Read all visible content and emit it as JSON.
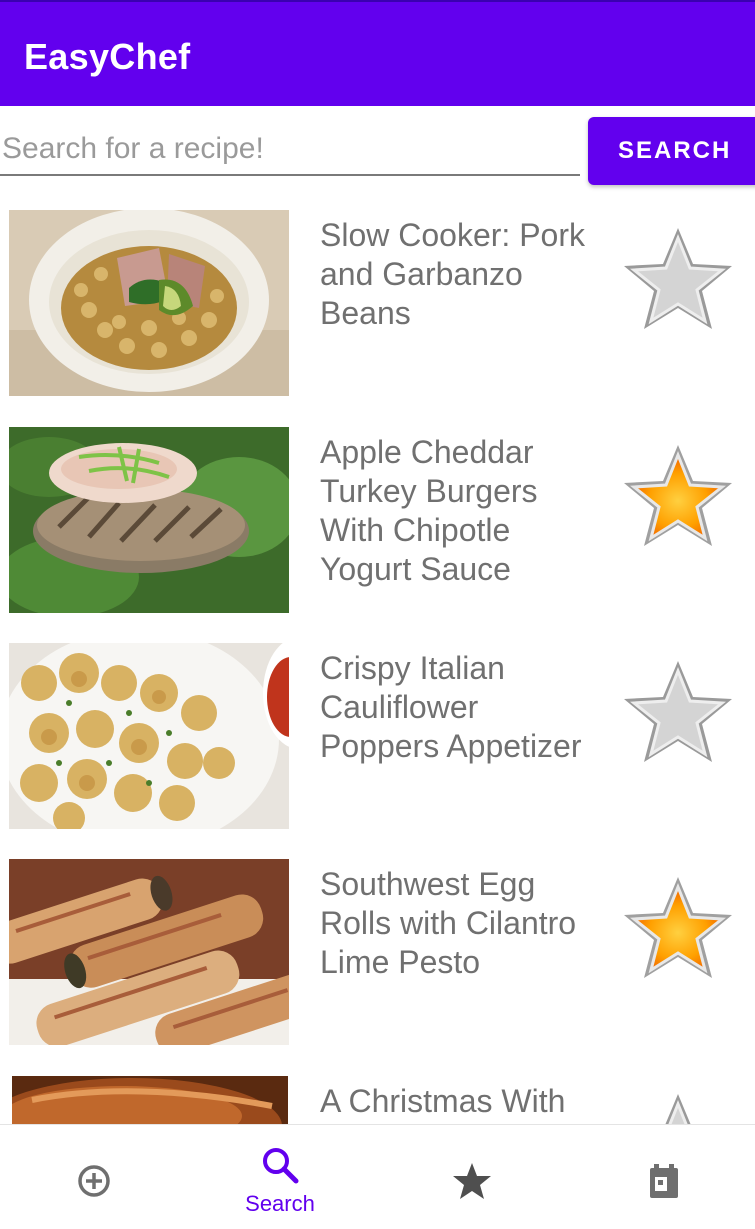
{
  "app_bar": {
    "title": "EasyChef"
  },
  "search": {
    "placeholder": "Search for a recipe!",
    "value": "",
    "button_label": "SEARCH"
  },
  "recipes": [
    {
      "title": "Slow Cooker: Pork and Garbanzo Beans",
      "favorite": false
    },
    {
      "title": "Apple Cheddar Turkey Burgers With Chipotle Yogurt Sauce",
      "favorite": true
    },
    {
      "title": "Crispy Italian Cauliflower Poppers Appetizer",
      "favorite": false
    },
    {
      "title": "Southwest Egg Rolls with Cilantro Lime Pesto",
      "favorite": true
    },
    {
      "title": "A Christmas With",
      "favorite": false
    }
  ],
  "bottom_nav": {
    "items": [
      {
        "icon": "add-circle-icon",
        "label": "",
        "active": false
      },
      {
        "icon": "search-icon",
        "label": "Search",
        "active": true
      },
      {
        "icon": "star-icon",
        "label": "",
        "active": false
      },
      {
        "icon": "calendar-icon",
        "label": "",
        "active": false
      }
    ]
  },
  "colors": {
    "primary": "#6200ee",
    "title_text": "#707070",
    "inactive_icon": "#6f6f6f",
    "star_gold": "#ffb300",
    "star_gray": "#c8c8c8"
  }
}
